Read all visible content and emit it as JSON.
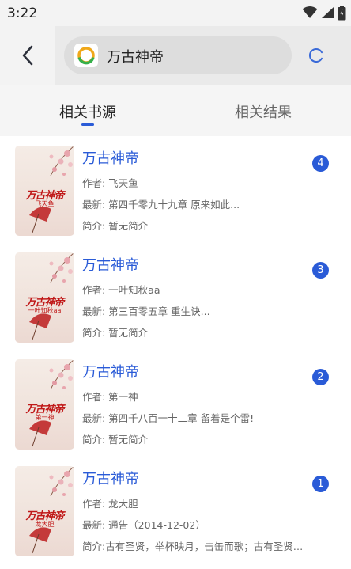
{
  "status_bar": {
    "time": "3:22"
  },
  "search": {
    "query": "万古神帝"
  },
  "tabs": [
    {
      "label": "相关书源",
      "active": true
    },
    {
      "label": "相关结果",
      "active": false
    }
  ],
  "colors": {
    "accent": "#2a5bd7",
    "cover_text": "#c01818"
  },
  "results": [
    {
      "title": "万古神帝",
      "cover_title": "万古神帝",
      "cover_author": "飞天鱼",
      "author": "作者: 飞天鱼",
      "latest": "最新: 第四千零九十九章 原来如此...",
      "intro": "简介: 暂无简介",
      "count": "4"
    },
    {
      "title": "万古神帝",
      "cover_title": "万古神帝",
      "cover_author": "一叶知秋aa",
      "author": "作者: 一叶知秋aa",
      "latest": "最新: 第三百零五章 重生诀...",
      "intro": "简介: 暂无简介",
      "count": "3"
    },
    {
      "title": "万古神帝",
      "cover_title": "万古神帝",
      "cover_author": "第一神",
      "author": "作者: 第一神",
      "latest": "最新: 第四千八百一十二章 留着是个雷!",
      "intro": "简介: 暂无简介",
      "count": "2"
    },
    {
      "title": "万古神帝",
      "cover_title": "万古神帝",
      "cover_author": "龙大胆",
      "author": "作者: 龙大胆",
      "latest": "最新: 通告（2014-12-02）",
      "intro": "简介:古有圣贤，举杯映月，击缶而歌；古有圣贤，...",
      "count": "1"
    }
  ]
}
